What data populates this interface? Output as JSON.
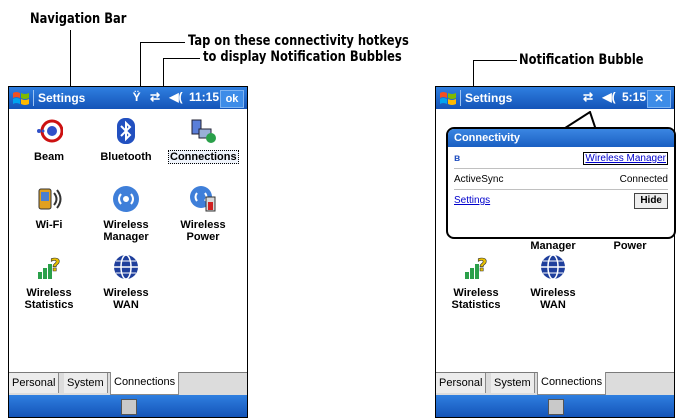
{
  "callouts": {
    "navigation_bar": "Navigation Bar",
    "tap_line1": "Tap on these connectivity hotkeys",
    "tap_line2": "to display Notification Bubbles",
    "notification_bubble": "Notification Bubble"
  },
  "left_screen": {
    "nav_title": "Settings",
    "nav_time": "11:15",
    "ok_label": "ok",
    "apps": [
      {
        "label1": "Beam",
        "label2": ""
      },
      {
        "label1": "Bluetooth",
        "label2": ""
      },
      {
        "label1": "Connections",
        "label2": ""
      },
      {
        "label1": "Wi-Fi",
        "label2": ""
      },
      {
        "label1": "Wireless",
        "label2": "Manager"
      },
      {
        "label1": "Wireless",
        "label2": "Power"
      },
      {
        "label1": "Wireless",
        "label2": "Statistics"
      },
      {
        "label1": "Wireless",
        "label2": "WAN"
      }
    ],
    "tabs": [
      "Personal",
      "System",
      "Connections"
    ]
  },
  "right_screen": {
    "nav_title": "Settings",
    "nav_time": "5:15",
    "close_label": "✕",
    "partial_labels": [
      "Manager",
      "Power"
    ],
    "apps": [
      {
        "label1": "Wireless",
        "label2": "Statistics"
      },
      {
        "label1": "Wireless",
        "label2": "WAN"
      }
    ],
    "tabs": [
      "Personal",
      "System",
      "Connections"
    ],
    "bubble": {
      "title": "Connectivity",
      "wireless_manager_link": "Wireless Manager",
      "activesync_label": "ActiveSync",
      "activesync_status": "Connected",
      "settings_link": "Settings",
      "hide_button": "Hide"
    }
  },
  "colors": {
    "nav_blue": "#1f6ad0",
    "link": "#0000cc"
  }
}
